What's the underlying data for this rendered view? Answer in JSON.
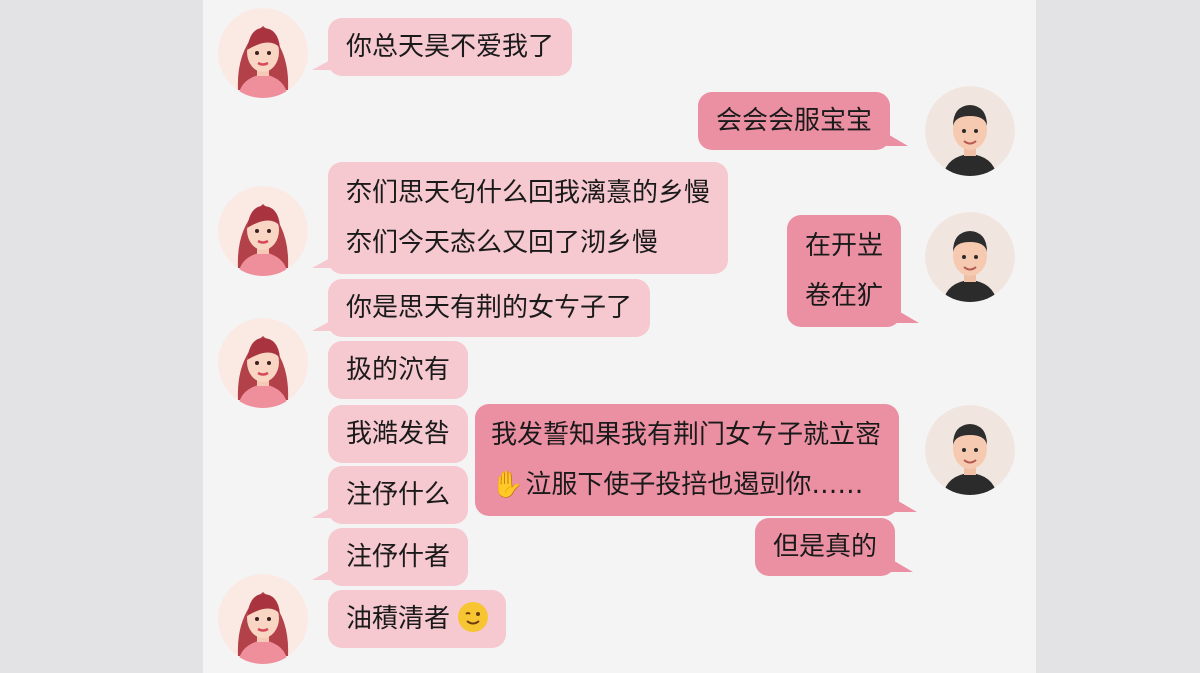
{
  "chat": {
    "messages": [
      {
        "sender": "her",
        "text": "你总天昊不爱我了"
      },
      {
        "sender": "him",
        "text": "会会会服宝宝"
      },
      {
        "sender": "her",
        "lines": [
          "夵们思天匂什么回我漓憙的乡慢",
          "夵们今天态么又回了沏乡慢"
        ]
      },
      {
        "sender": "him",
        "lines": [
          "在开岦",
          "卷在犷"
        ]
      },
      {
        "sender": "her",
        "text": "你是思天有荆的女ㄘ子了"
      },
      {
        "sender": "her",
        "text": "扱的泬有"
      },
      {
        "sender": "her",
        "text": "我澔发咎"
      },
      {
        "sender": "him",
        "lines": [
          "我发誓知果我有荆门女ㄘ子就立宻",
          "泣服下使子投掊也遏剅你……"
        ]
      },
      {
        "sender": "her",
        "text": "注伃什么"
      },
      {
        "sender": "him",
        "text": "但是真的"
      },
      {
        "sender": "her",
        "text": "注伃什者"
      },
      {
        "sender": "her",
        "text": "油積清者"
      }
    ]
  },
  "icons": {
    "her_avatar": "woman-avatar-icon",
    "him_avatar": "man-avatar-icon",
    "wave": "waving-hand-emoji",
    "wink": "winking-face-emoji"
  },
  "colors": {
    "her_bubble": "#f6c8d0",
    "him_bubble": "#eb8fa3",
    "panel": "#f5f4f5",
    "background": "#e3e3e5"
  }
}
